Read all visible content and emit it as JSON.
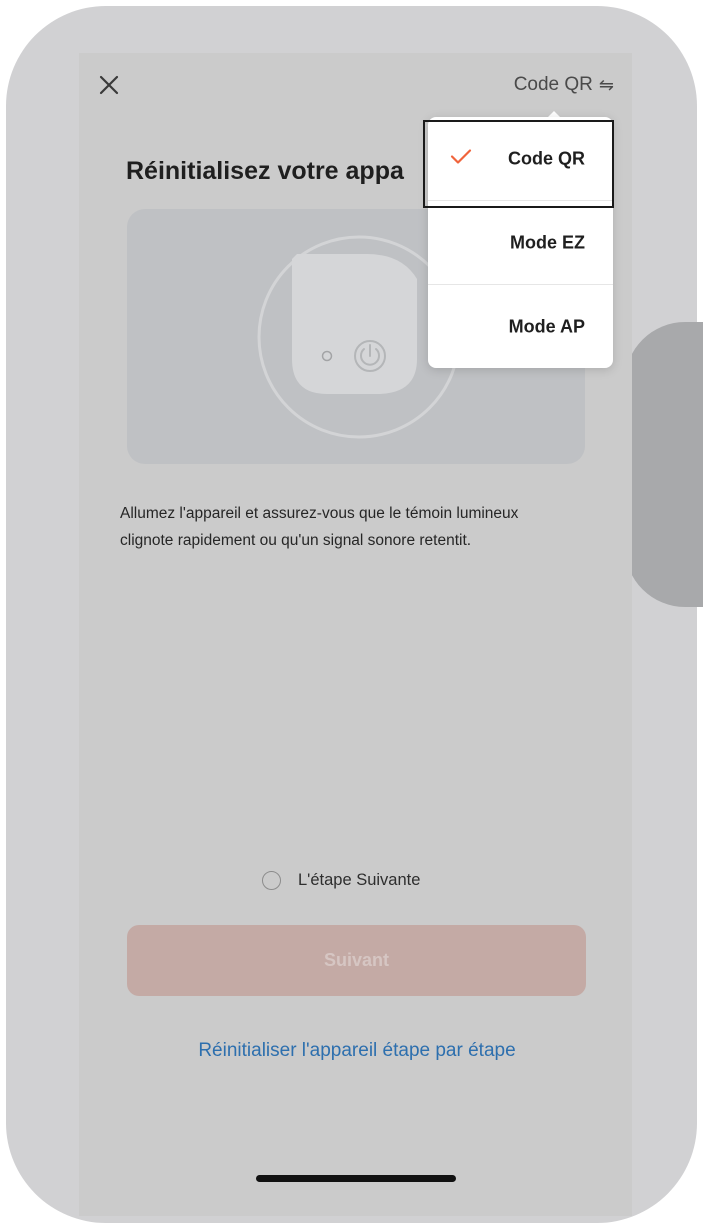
{
  "header": {
    "close_icon": "close-icon",
    "mode_label": "Code QR",
    "swap_icon": "⇋"
  },
  "main": {
    "title": "Réinitialisez votre appa",
    "device_icon": "power-icon",
    "instructions": "Allumez l'appareil et assurez-vous que le témoin lumineux clignote rapidement ou qu'un signal sonore retentit.",
    "step_checkbox_label": "L'étape Suivante",
    "step_checkbox_checked": false,
    "next_button_label": "Suivant",
    "next_button_enabled": false,
    "reset_link": "Réinitialiser l'appareil étape par étape"
  },
  "mode_menu": {
    "items": [
      {
        "label": "Code QR",
        "selected": true
      },
      {
        "label": "Mode EZ",
        "selected": false
      },
      {
        "label": "Mode AP",
        "selected": false
      }
    ],
    "check_color": "#f0643c"
  },
  "colors": {
    "accent": "#f0643c",
    "link": "#2d6fae",
    "disabled_button": "#c4aaa5"
  }
}
